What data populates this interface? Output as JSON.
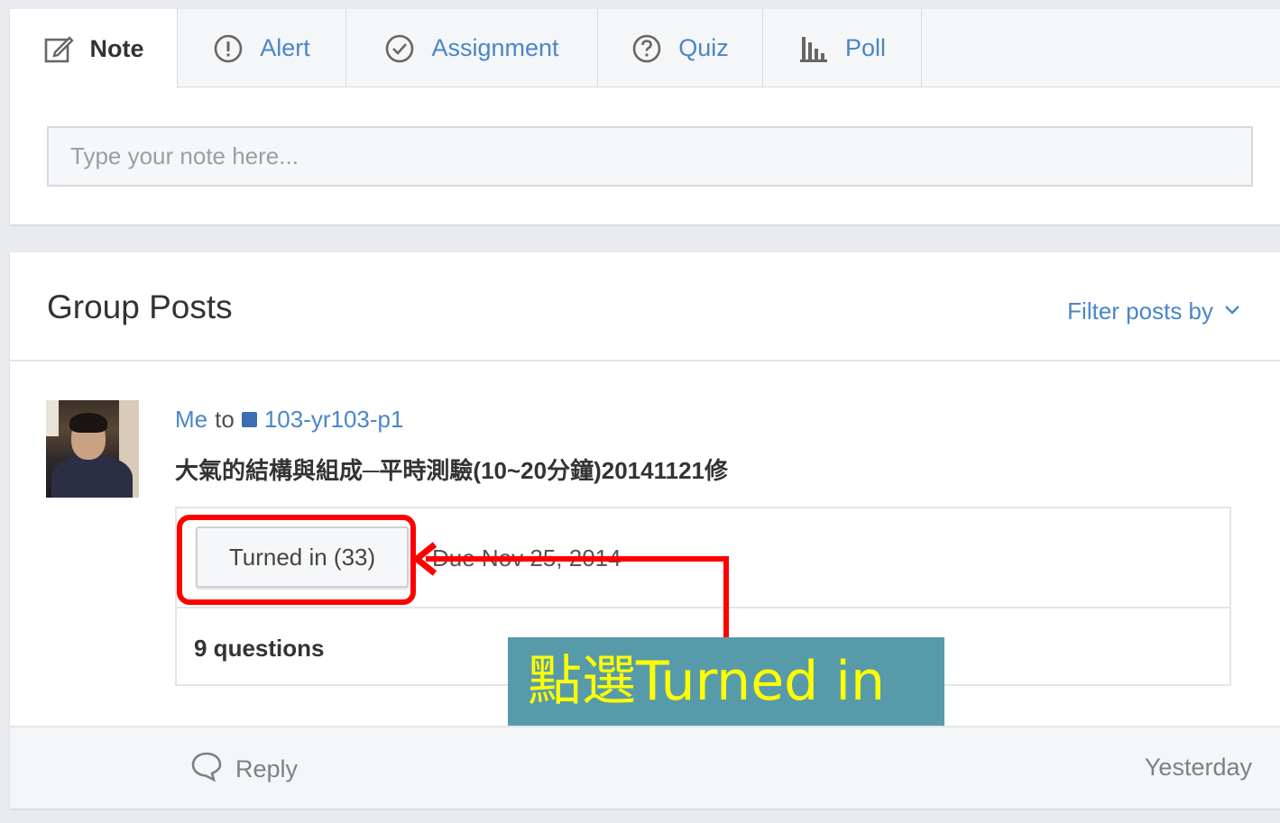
{
  "composer": {
    "tabs": [
      {
        "label": "Note",
        "icon": "edit-icon",
        "active": true
      },
      {
        "label": "Alert",
        "icon": "exclamation-circle-icon",
        "active": false
      },
      {
        "label": "Assignment",
        "icon": "check-circle-icon",
        "active": false
      },
      {
        "label": "Quiz",
        "icon": "question-circle-icon",
        "active": false
      },
      {
        "label": "Poll",
        "icon": "bar-chart-icon",
        "active": false
      }
    ],
    "note_placeholder": "Type your note here..."
  },
  "posts": {
    "title": "Group Posts",
    "filter_label": "Filter posts by",
    "post": {
      "author": "Me",
      "to_word": "to",
      "group": "103-yr103-p1",
      "title": "大氣的結構與組成─平時測驗(10~20分鐘)20141121修",
      "turned_in_label": "Turned in (33)",
      "due": "Due Nov 25, 2014",
      "question_count": "9 questions",
      "reply_label": "Reply",
      "timestamp": "Yesterday"
    }
  },
  "annotation": {
    "callout_text": "點選Turned in",
    "highlight_color": "#ff0000",
    "callout_bg": "#579bab",
    "callout_text_color": "#ffff00"
  },
  "colors": {
    "link": "#4a86c8",
    "group_square": "#3d6db2"
  }
}
